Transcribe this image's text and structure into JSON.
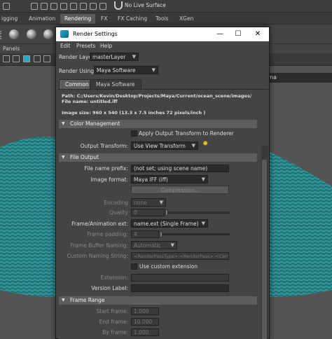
{
  "maya": {
    "live_surface": "No Live Surface",
    "shelf_tabs": [
      "igging",
      "Animation",
      "Rendering",
      "FX",
      "FX Caching",
      "Tools",
      "XGen"
    ],
    "panels_menu": "Panels",
    "camera_field": "ma"
  },
  "window": {
    "title": "Render Settings",
    "minimize_glyph": "—",
    "maximize_glyph": "☐",
    "close_glyph": "✕",
    "menus": [
      "Edit",
      "Presets",
      "Help"
    ],
    "render_layer_label": "Render Layer",
    "render_layer_value": "masterLayer",
    "render_using_label": "Render Using",
    "render_using_value": "Maya Software",
    "tabs": [
      "Common",
      "Maya Software"
    ]
  },
  "content": {
    "path_line": "Path: C:/Users/Kevin/Desktop/Projects/Maya/Current/ocean_scene/images/",
    "file_name_line": "File name:  untitled.iff",
    "image_size_line": "Image size: 960 x 540 (13.3 x 7.5 inches 72 pixels/inch )",
    "sections": [
      "Color Management",
      "File Output",
      "Frame Range"
    ],
    "color": {
      "apply_output_transform": "Apply Output Transform to Renderer",
      "output_transform_label": "Output Transform:",
      "output_transform_value": "Use View Transform"
    },
    "file_output": {
      "file_name_prefix_label": "File name prefix:",
      "file_name_prefix_value": "(not set; using scene name)",
      "image_format_label": "Image format:",
      "image_format_value": "Maya IFF (iff)",
      "compression_button": "Compression...",
      "encoding_label": "Encoding",
      "encoding_value": "none",
      "quality_label": "Quality",
      "quality_value": "0",
      "frame_ext_label": "Frame/Animation ext:",
      "frame_ext_value": "name.ext (Single Frame)",
      "frame_padding_label": "Frame padding:",
      "frame_padding_value": "4",
      "frame_buffer_naming_label": "Frame Buffer Naming:",
      "frame_buffer_naming_value": "Automatic",
      "custom_naming_label": "Custom Naming String:",
      "custom_naming_value": "<RenderPassType>:<RenderPass>.<Camera>",
      "use_custom_extension": "Use custom extension",
      "extension_label": "Extension:",
      "version_label": "Version Label:"
    },
    "frame_range": {
      "start_label": "Start frame:",
      "start_value": "1.000",
      "end_label": "End frame:",
      "end_value": "10.000",
      "by_label": "By frame:",
      "by_value": "1.000"
    }
  }
}
